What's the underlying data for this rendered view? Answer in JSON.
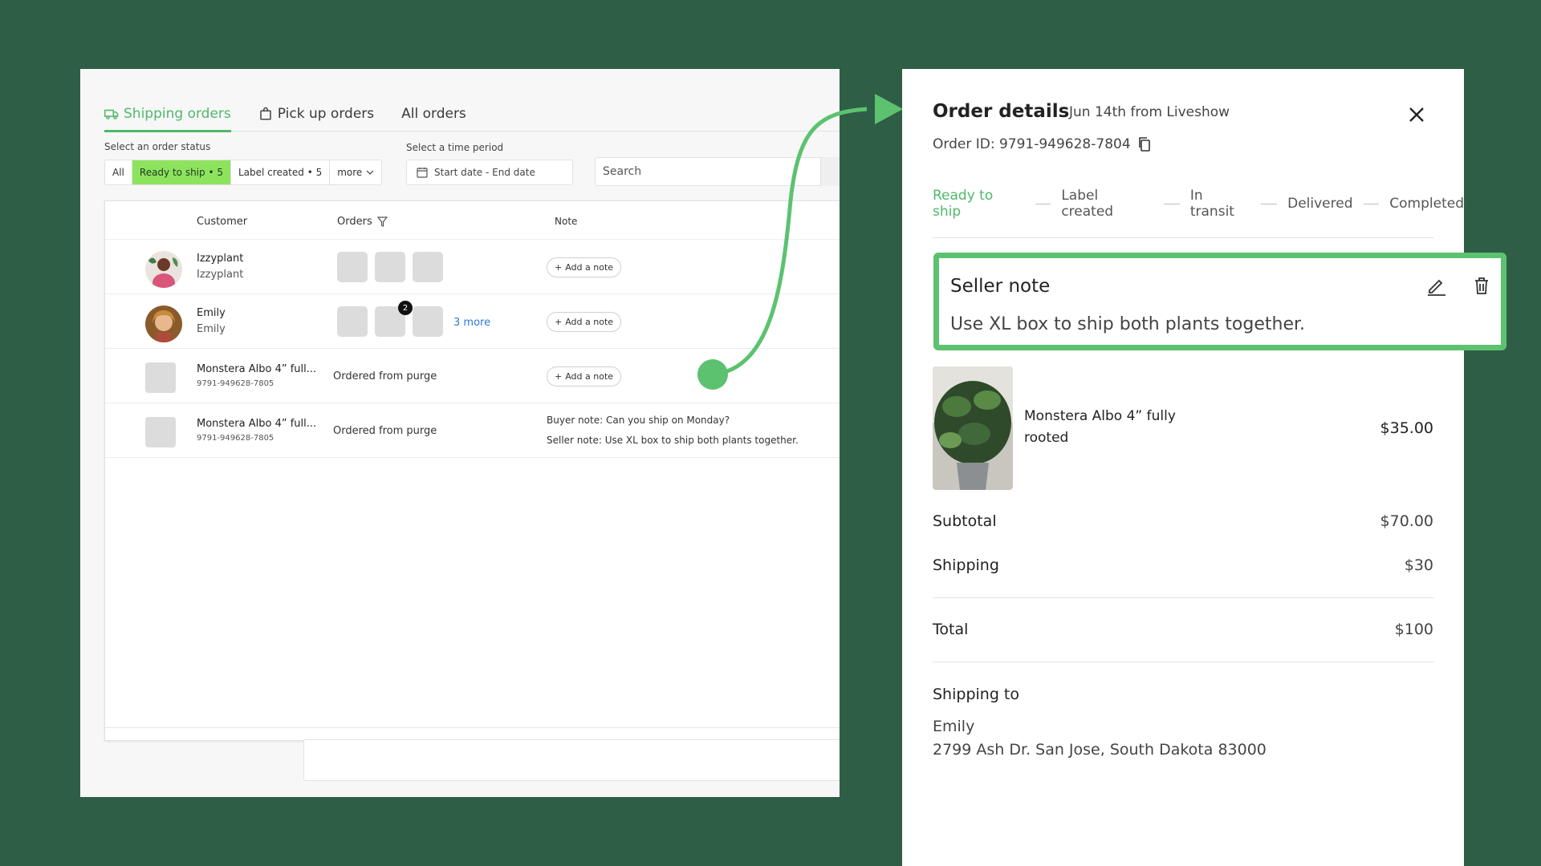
{
  "tabs": [
    {
      "label": "Shipping orders",
      "icon": "truck-icon",
      "active": true
    },
    {
      "label": "Pick up orders",
      "icon": "bag-icon",
      "active": false
    },
    {
      "label": "All orders",
      "active": false
    }
  ],
  "filters": {
    "status_label": "Select an order status",
    "status_options": [
      "All",
      "Ready to ship • 5",
      "Label created • 5",
      "more"
    ],
    "time_label": "Select a time period",
    "date_placeholder": "Start date - End date",
    "search_placeholder": "Search"
  },
  "table": {
    "headers": {
      "customer": "Customer",
      "orders": "Orders",
      "note": "Note"
    },
    "rows": [
      {
        "name": "Izzyplant",
        "sub": "Izzyplant",
        "note_button": "Add a note"
      },
      {
        "name": "Emily",
        "sub": "Emily",
        "badge": "2",
        "more": "3 more",
        "note_button": "Add a note"
      },
      {
        "name": "Monstera Albo 4” full...",
        "sub": "9791-949628-7805",
        "ordered": "Ordered from purge",
        "note_button": "Add a note"
      },
      {
        "name": "Monstera Albo 4” full...",
        "sub": "9791-949628-7805",
        "ordered": "Ordered from purge",
        "buyer_note": "Buyer note: Can you ship on Monday?",
        "seller_note": "Seller note: Use XL box to ship both plants together."
      }
    ]
  },
  "details": {
    "title": "Order details",
    "date": "Jun 14th from Liveshow",
    "order_id": "Order ID: 9791-949628-7804",
    "steps": [
      "Ready to ship",
      "Label created",
      "In transit",
      "Delivered",
      "Completed"
    ],
    "seller_note_title": "Seller note",
    "seller_note_text": "Use XL box to ship both plants together.",
    "product_name": "Monstera Albo 4” fully rooted",
    "product_price": "$35.00",
    "subtotal_label": "Subtotal",
    "subtotal_value": "$70.00",
    "shipping_label": "Shipping",
    "shipping_value": "$30",
    "total_label": "Total",
    "total_value": "$100",
    "shipping_to_label": "Shipping to",
    "ship_name": "Emily",
    "ship_address": "2799 Ash Dr. San Jose, South Dakota 83000"
  },
  "colors": {
    "accent": "#4fb86a",
    "active_filter": "#8ee35e",
    "background": "#2f5e47",
    "link": "#2b7bd8"
  }
}
